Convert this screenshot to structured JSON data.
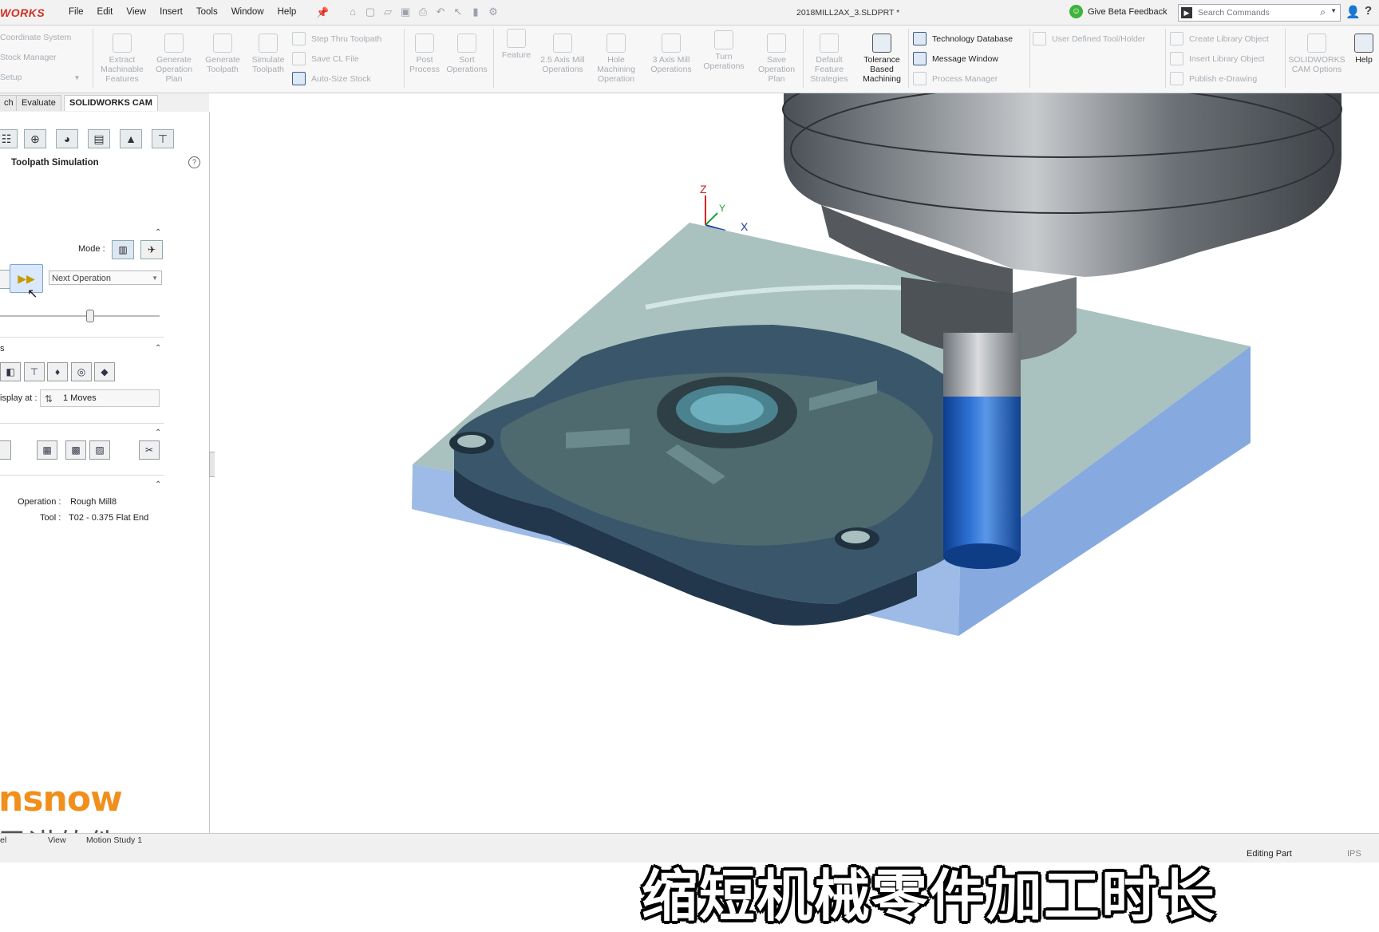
{
  "titlebar": {
    "logo": "WORKS",
    "menus": [
      "File",
      "Edit",
      "View",
      "Insert",
      "Tools",
      "Window",
      "Help"
    ],
    "document_title": "2018MILL2AX_3.SLDPRT *",
    "feedback": "Give Beta Feedback",
    "search_placeholder": "Search Commands"
  },
  "ribbon": {
    "left_rows": [
      "Coordinate System",
      "Stock Manager",
      "Setup"
    ],
    "buttons": [
      "Extract Machinable Features",
      "Generate Operation Plan",
      "Generate Toolpath",
      "Simulate Toolpath"
    ],
    "mid_rows": [
      "Step Thru Toolpath",
      "Save CL File",
      "Auto-Size Stock"
    ],
    "buttons2": [
      "Post Process",
      "Sort Operations",
      "Feature",
      "2.5 Axis Mill Operations",
      "Hole Machining Operation",
      "3 Axis Mill Operations",
      "Turn Operations",
      "Save Operation Plan",
      "Default Feature Strategies",
      "Tolerance Based Machining"
    ],
    "right_rows": [
      "Technology Database",
      "Message Window",
      "Process Manager"
    ],
    "user_defined": "User Defined Tool/Holder",
    "lib_rows": [
      "Create Library Object",
      "Insert Library Object",
      "Publish e-Drawing"
    ],
    "cam_options": "SOLIDWORKS CAM Options",
    "help": "Help"
  },
  "tabs": [
    "ch",
    "Evaluate",
    "SOLIDWORKS CAM"
  ],
  "panel": {
    "title": "Toolpath Simulation",
    "mode_label": "Mode :",
    "next_operation": "Next Operation",
    "display_at_label": "isplay at :",
    "moves_value": "1 Moves",
    "operation_label": "Operation :",
    "operation_value": "Rough Mill8",
    "tool_label": "Tool :",
    "tool_value": "T02 - 0.375 Flat End",
    "section_s": "s"
  },
  "axes": {
    "z": "Z",
    "y": "Y",
    "x": "X"
  },
  "statusbar": {
    "tabs": [
      "el",
      "View",
      "Motion Study 1"
    ],
    "edit_state": "Editing Part",
    "units": "IPS"
  },
  "watermark": {
    "brand": "nsnow",
    "chinese": "思诺软件"
  },
  "subtitle": "缩短机械零件加工时长",
  "colors": {
    "accent": "#3a6fc4",
    "stock": "#a9c4e8",
    "part": "#3c5468",
    "tool_blue": "#1d5fbf",
    "watermark": "#f08f1c"
  }
}
